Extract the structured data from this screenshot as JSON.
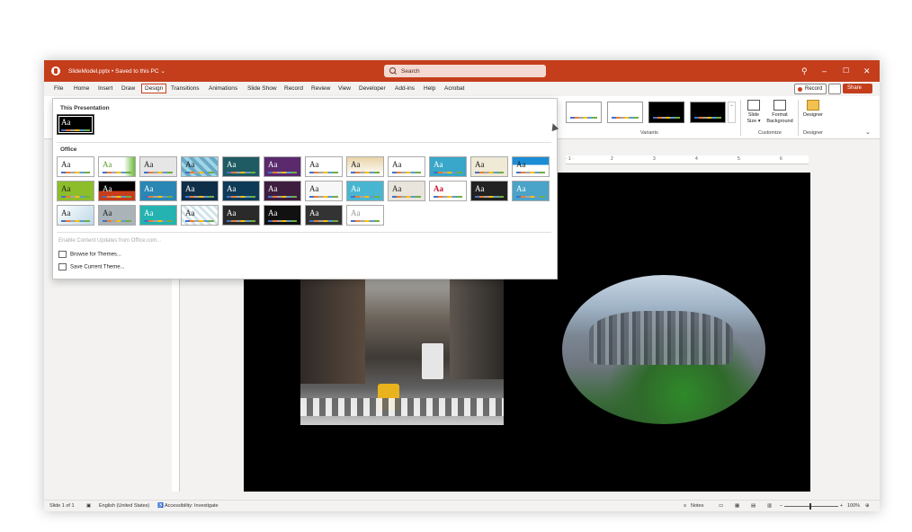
{
  "titlebar": {
    "doc_title": "SlideModel.pptx • Saved to this PC ⌄",
    "search_placeholder": "Search",
    "controls": [
      "lightbulb-icon",
      "minimize-icon",
      "maximize-icon",
      "close-icon"
    ]
  },
  "tabs": [
    "File",
    "Home",
    "Insert",
    "Draw",
    "Design",
    "Transitions",
    "Animations",
    "Slide Show",
    "Record",
    "Review",
    "View",
    "Developer",
    "Add-ins",
    "Help",
    "Acrobat"
  ],
  "active_tab": "Design",
  "actions": {
    "record": "Record",
    "share": "Share"
  },
  "ribbon": {
    "variants_label": "Variants",
    "customize_label": "Customize",
    "designer_group_label": "Designer",
    "slide_size": "Slide Size ▾",
    "format_background": "Format Background",
    "designer_button": "Designer"
  },
  "theme_menu": {
    "this_presentation": "This Presentation",
    "office": "Office",
    "aa": "Aa",
    "enable_updates": "Enable Content Updates from Office.com...",
    "browse": "Browse for Themes...",
    "save": "Save Current Theme..."
  },
  "ruler": [
    "· 1 ·",
    "1",
    "2",
    "3",
    "4",
    "5",
    "6"
  ],
  "statusbar": {
    "slide": "Slide 1 of 1",
    "language": "English (United States)",
    "accessibility": "Accessibility: Investigate",
    "notes": "Notes",
    "zoom": "100%"
  }
}
